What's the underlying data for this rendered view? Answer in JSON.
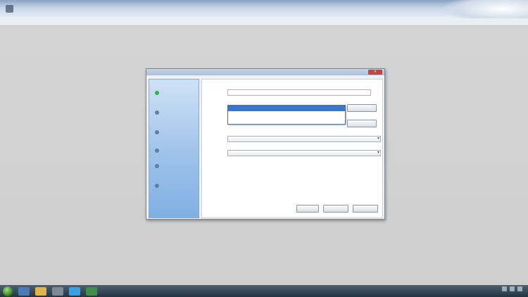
{
  "app": {
    "title": ""
  },
  "dialog": {
    "title": "",
    "close_label": "×",
    "steps": [
      {
        "label": "",
        "active": true
      },
      {
        "label": "",
        "active": false
      },
      {
        "label": "",
        "active": false
      },
      {
        "label": "",
        "active": false
      },
      {
        "label": "",
        "active": false
      },
      {
        "label": "",
        "active": false
      }
    ],
    "fields": {
      "name": {
        "label": "",
        "value": ""
      },
      "source": {
        "label": "",
        "value": ""
      },
      "target": {
        "label": "",
        "value": ""
      },
      "type": {
        "label": "",
        "value": ""
      },
      "option": {
        "label": "",
        "value": ""
      }
    },
    "dropdown_options": [
      "",
      ""
    ],
    "browse_label": "",
    "browse2_label": "",
    "info_lines": [
      "",
      ""
    ],
    "buttons": {
      "back": "",
      "next": "",
      "cancel": ""
    }
  },
  "taskbar": {
    "time": "",
    "date": ""
  },
  "colors": {
    "accent": "#3a75d0",
    "sidebar": "#9ec2ea",
    "active_step": "#2db34a"
  }
}
